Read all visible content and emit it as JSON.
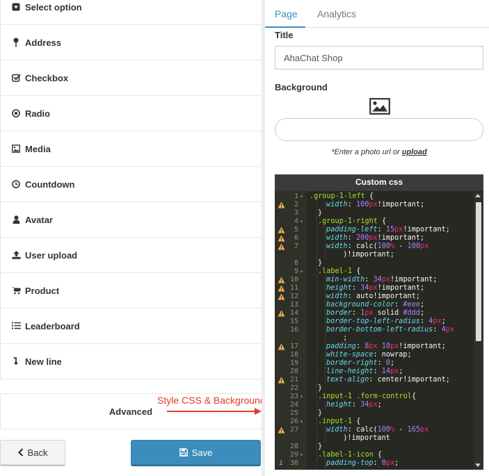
{
  "sidebar": {
    "items": [
      {
        "label": "Select option",
        "icon": "caret-square-icon"
      },
      {
        "label": "Address",
        "icon": "map-pin-icon"
      },
      {
        "label": "Checkbox",
        "icon": "check-square-icon"
      },
      {
        "label": "Radio",
        "icon": "radio-icon"
      },
      {
        "label": "Media",
        "icon": "image-icon"
      },
      {
        "label": "Countdown",
        "icon": "clock-icon"
      },
      {
        "label": "Avatar",
        "icon": "user-icon"
      },
      {
        "label": "User upload",
        "icon": "upload-icon"
      },
      {
        "label": "Product",
        "icon": "cart-icon"
      },
      {
        "label": "Leaderboard",
        "icon": "list-icon"
      },
      {
        "label": "New line",
        "icon": "level-down-icon"
      }
    ],
    "advanced_label": "Advanced"
  },
  "annotation": {
    "text": "Style CSS & Background",
    "color": "#e03a2f"
  },
  "footer": {
    "back_label": "Back",
    "save_label": "Save",
    "save_color": "#3c8dbc"
  },
  "tabs": {
    "page": "Page",
    "analytics": "Analytics",
    "active_color": "#3c8dbc"
  },
  "form": {
    "title_label": "Title",
    "title_value": "AhaChat Shop",
    "background_label": "Background",
    "hint_prefix": "*Enter a photo url or ",
    "hint_link": "upload"
  },
  "editor": {
    "header": "Custom css",
    "lines": [
      {
        "n": "1",
        "m": "",
        "f": true,
        "i": 0,
        "t": [
          [
            "sel",
            ".group-1-left"
          ],
          [
            "val",
            " {"
          ]
        ]
      },
      {
        "n": "2",
        "m": "w",
        "f": false,
        "i": 2,
        "t": [
          [
            "prop",
            "width"
          ],
          [
            "val",
            ": "
          ],
          [
            "num",
            "100"
          ],
          [
            "unit",
            "px"
          ],
          [
            "val",
            "!important;"
          ]
        ]
      },
      {
        "n": "3",
        "m": "",
        "f": false,
        "i": 1,
        "t": [
          [
            "val",
            "}"
          ]
        ]
      },
      {
        "n": "4",
        "m": "",
        "f": true,
        "i": 1,
        "t": [
          [
            "sel",
            ".group-1-right"
          ],
          [
            "val",
            " {"
          ]
        ]
      },
      {
        "n": "5",
        "m": "w",
        "f": false,
        "i": 2,
        "t": [
          [
            "prop",
            "padding-left"
          ],
          [
            "val",
            ": "
          ],
          [
            "num",
            "15"
          ],
          [
            "unit",
            "px"
          ],
          [
            "val",
            "!important;"
          ]
        ]
      },
      {
        "n": "6",
        "m": "w",
        "f": false,
        "i": 2,
        "t": [
          [
            "prop",
            "width"
          ],
          [
            "val",
            ": "
          ],
          [
            "num",
            "200"
          ],
          [
            "unit",
            "px"
          ],
          [
            "val",
            "!important;"
          ]
        ]
      },
      {
        "n": "7",
        "m": "w",
        "f": false,
        "i": 2,
        "t": [
          [
            "prop",
            "width"
          ],
          [
            "val",
            ": calc("
          ],
          [
            "num",
            "100"
          ],
          [
            "unit",
            "%"
          ],
          [
            "val",
            " - "
          ],
          [
            "num",
            "100"
          ],
          [
            "unit",
            "px"
          ]
        ]
      },
      {
        "n": "",
        "m": "",
        "f": false,
        "i": 3,
        "t": [
          [
            "val",
            "  )!important;"
          ]
        ]
      },
      {
        "n": "8",
        "m": "",
        "f": false,
        "i": 1,
        "t": [
          [
            "val",
            "}"
          ]
        ]
      },
      {
        "n": "9",
        "m": "",
        "f": true,
        "i": 1,
        "t": [
          [
            "sel",
            ".label-1"
          ],
          [
            "val",
            " {"
          ]
        ]
      },
      {
        "n": "10",
        "m": "w",
        "f": false,
        "i": 2,
        "t": [
          [
            "prop",
            "min-width"
          ],
          [
            "val",
            ": "
          ],
          [
            "num",
            "34"
          ],
          [
            "unit",
            "px"
          ],
          [
            "val",
            "!important;"
          ]
        ]
      },
      {
        "n": "11",
        "m": "w",
        "f": false,
        "i": 2,
        "t": [
          [
            "prop",
            "height"
          ],
          [
            "val",
            ": "
          ],
          [
            "num",
            "34"
          ],
          [
            "unit",
            "px"
          ],
          [
            "val",
            "!important;"
          ]
        ]
      },
      {
        "n": "12",
        "m": "w",
        "f": false,
        "i": 2,
        "t": [
          [
            "prop",
            "width"
          ],
          [
            "val",
            ": auto!important;"
          ]
        ]
      },
      {
        "n": "13",
        "m": "",
        "f": false,
        "i": 2,
        "t": [
          [
            "prop",
            "background-color"
          ],
          [
            "val",
            ": "
          ],
          [
            "num",
            "#eee"
          ],
          [
            "val",
            ";"
          ]
        ]
      },
      {
        "n": "14",
        "m": "w",
        "f": false,
        "i": 2,
        "t": [
          [
            "prop",
            "border"
          ],
          [
            "val",
            ": "
          ],
          [
            "num",
            "1"
          ],
          [
            "unit",
            "px"
          ],
          [
            "val",
            " solid "
          ],
          [
            "num",
            "#ddd"
          ],
          [
            "val",
            ";"
          ]
        ]
      },
      {
        "n": "15",
        "m": "",
        "f": false,
        "i": 2,
        "t": [
          [
            "prop",
            "border-top-left-radius"
          ],
          [
            "val",
            ": "
          ],
          [
            "num",
            "4"
          ],
          [
            "unit",
            "px"
          ],
          [
            "val",
            ";"
          ]
        ]
      },
      {
        "n": "16",
        "m": "",
        "f": false,
        "i": 2,
        "t": [
          [
            "prop",
            "border-bottom-left-radius"
          ],
          [
            "val",
            ": "
          ],
          [
            "num",
            "4"
          ],
          [
            "unit",
            "px"
          ]
        ]
      },
      {
        "n": "",
        "m": "",
        "f": false,
        "i": 3,
        "t": [
          [
            "val",
            "  ;"
          ]
        ]
      },
      {
        "n": "17",
        "m": "w",
        "f": false,
        "i": 2,
        "t": [
          [
            "prop",
            "padding"
          ],
          [
            "val",
            ": "
          ],
          [
            "num",
            "8"
          ],
          [
            "unit",
            "px"
          ],
          [
            "val",
            " "
          ],
          [
            "num",
            "10"
          ],
          [
            "unit",
            "px"
          ],
          [
            "val",
            "!important;"
          ]
        ]
      },
      {
        "n": "18",
        "m": "",
        "f": false,
        "i": 2,
        "t": [
          [
            "prop",
            "white-space"
          ],
          [
            "val",
            ": nowrap;"
          ]
        ]
      },
      {
        "n": "19",
        "m": "",
        "f": false,
        "i": 2,
        "t": [
          [
            "prop",
            "border-right"
          ],
          [
            "val",
            ": "
          ],
          [
            "num",
            "0"
          ],
          [
            "val",
            ";"
          ]
        ]
      },
      {
        "n": "20",
        "m": "",
        "f": false,
        "i": 2,
        "t": [
          [
            "prop",
            "line-height"
          ],
          [
            "val",
            ": "
          ],
          [
            "num",
            "14"
          ],
          [
            "unit",
            "px"
          ],
          [
            "val",
            ";"
          ]
        ]
      },
      {
        "n": "21",
        "m": "w",
        "f": false,
        "i": 2,
        "t": [
          [
            "prop",
            "text-align"
          ],
          [
            "val",
            ": center!important;"
          ]
        ]
      },
      {
        "n": "22",
        "m": "",
        "f": false,
        "i": 1,
        "t": [
          [
            "val",
            "}"
          ]
        ]
      },
      {
        "n": "23",
        "m": "",
        "f": true,
        "i": 1,
        "t": [
          [
            "sel",
            ".input-1 .form-control"
          ],
          [
            "val",
            "{"
          ]
        ]
      },
      {
        "n": "24",
        "m": "",
        "f": false,
        "i": 2,
        "t": [
          [
            "prop",
            "height"
          ],
          [
            "val",
            ": "
          ],
          [
            "num",
            "34"
          ],
          [
            "unit",
            "px"
          ],
          [
            "val",
            ";"
          ]
        ]
      },
      {
        "n": "25",
        "m": "",
        "f": false,
        "i": 1,
        "t": [
          [
            "val",
            "}"
          ]
        ]
      },
      {
        "n": "26",
        "m": "",
        "f": true,
        "i": 1,
        "t": [
          [
            "sel",
            ".input-1"
          ],
          [
            "val",
            " {"
          ]
        ]
      },
      {
        "n": "27",
        "m": "w",
        "f": false,
        "i": 2,
        "t": [
          [
            "prop",
            "width"
          ],
          [
            "val",
            ": calc("
          ],
          [
            "num",
            "100"
          ],
          [
            "unit",
            "%"
          ],
          [
            "val",
            " - "
          ],
          [
            "num",
            "165"
          ],
          [
            "unit",
            "px"
          ]
        ]
      },
      {
        "n": "",
        "m": "",
        "f": false,
        "i": 3,
        "t": [
          [
            "val",
            "  )!important"
          ]
        ]
      },
      {
        "n": "28",
        "m": "",
        "f": false,
        "i": 1,
        "t": [
          [
            "val",
            "}"
          ]
        ]
      },
      {
        "n": "29",
        "m": "",
        "f": true,
        "i": 1,
        "t": [
          [
            "sel",
            ".label-1-icon"
          ],
          [
            "val",
            " {"
          ]
        ]
      },
      {
        "n": "30",
        "m": "i",
        "f": false,
        "i": 2,
        "t": [
          [
            "prop",
            "padding-top"
          ],
          [
            "val",
            ": "
          ],
          [
            "num",
            "0"
          ],
          [
            "unit",
            "px"
          ],
          [
            "val",
            ";"
          ]
        ]
      }
    ]
  }
}
